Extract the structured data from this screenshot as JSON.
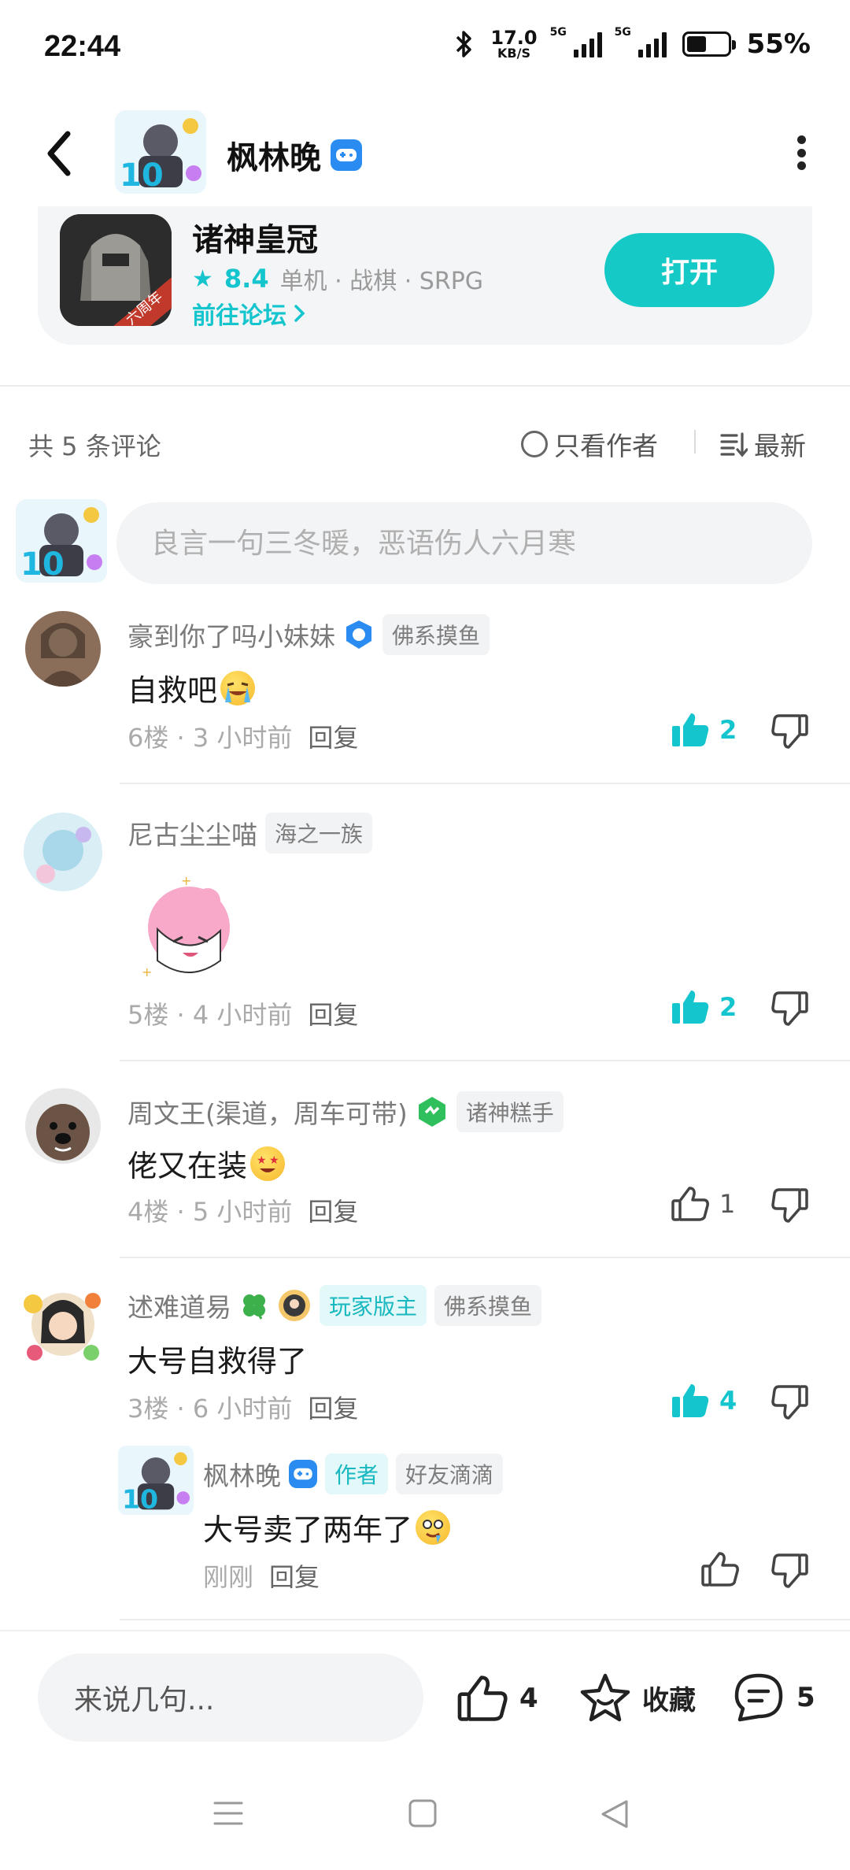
{
  "status_bar": {
    "time": "22:44",
    "net_speed_value": "17.0",
    "net_speed_unit": "KB/S",
    "signal1_label": "5G",
    "signal2_label": "5G",
    "battery": "55%"
  },
  "header": {
    "username": "枫林晚",
    "back_icon": "chevron-left-icon",
    "more_icon": "more-vertical-icon"
  },
  "app_card": {
    "title": "诸神皇冠",
    "rating": "8.4",
    "tags": "单机 · 战棋 · SRPG",
    "forum_link": "前往论坛",
    "open_label": "打开",
    "ribbon": "六周年"
  },
  "filter": {
    "count_label": "共 5 条评论",
    "author_only": "只看作者",
    "sort": "最新"
  },
  "comment_box": {
    "placeholder": "良言一句三冬暖，恶语伤人六月寒"
  },
  "comments": [
    {
      "user": "豪到你了吗小妹妹",
      "tag": "佛系摸鱼",
      "text": "自救吧",
      "floor_time": "6楼 · 3 小时前",
      "reply": "回复",
      "likes": "2"
    },
    {
      "user": "尼古尘尘喵",
      "tag": "海之一族",
      "text": "",
      "floor_time": "5楼 · 4 小时前",
      "reply": "回复",
      "likes": "2"
    },
    {
      "user": "周文王(渠道，周车可带)",
      "tag": "诸神糕手",
      "text": "佬又在装",
      "floor_time": "4楼 · 5 小时前",
      "reply": "回复",
      "likes": "1"
    },
    {
      "user": "述难道易",
      "tag_mod": "玩家版主",
      "tag": "佛系摸鱼",
      "text": "大号自救得了",
      "floor_time": "3楼 · 6 小时前",
      "reply": "回复",
      "likes": "4"
    }
  ],
  "sub_reply": {
    "user": "枫林晚",
    "tag_author": "作者",
    "tag": "好友滴滴",
    "text": "大号卖了两年了",
    "time": "刚刚",
    "reply": "回复"
  },
  "bottom_bar": {
    "say_placeholder": "来说几句...",
    "likes": "4",
    "favorite": "收藏",
    "comments": "5"
  },
  "colors": {
    "accent": "#15c5ce",
    "brand_button": "#15c9c6",
    "verified_blue": "#2a8cf0"
  }
}
